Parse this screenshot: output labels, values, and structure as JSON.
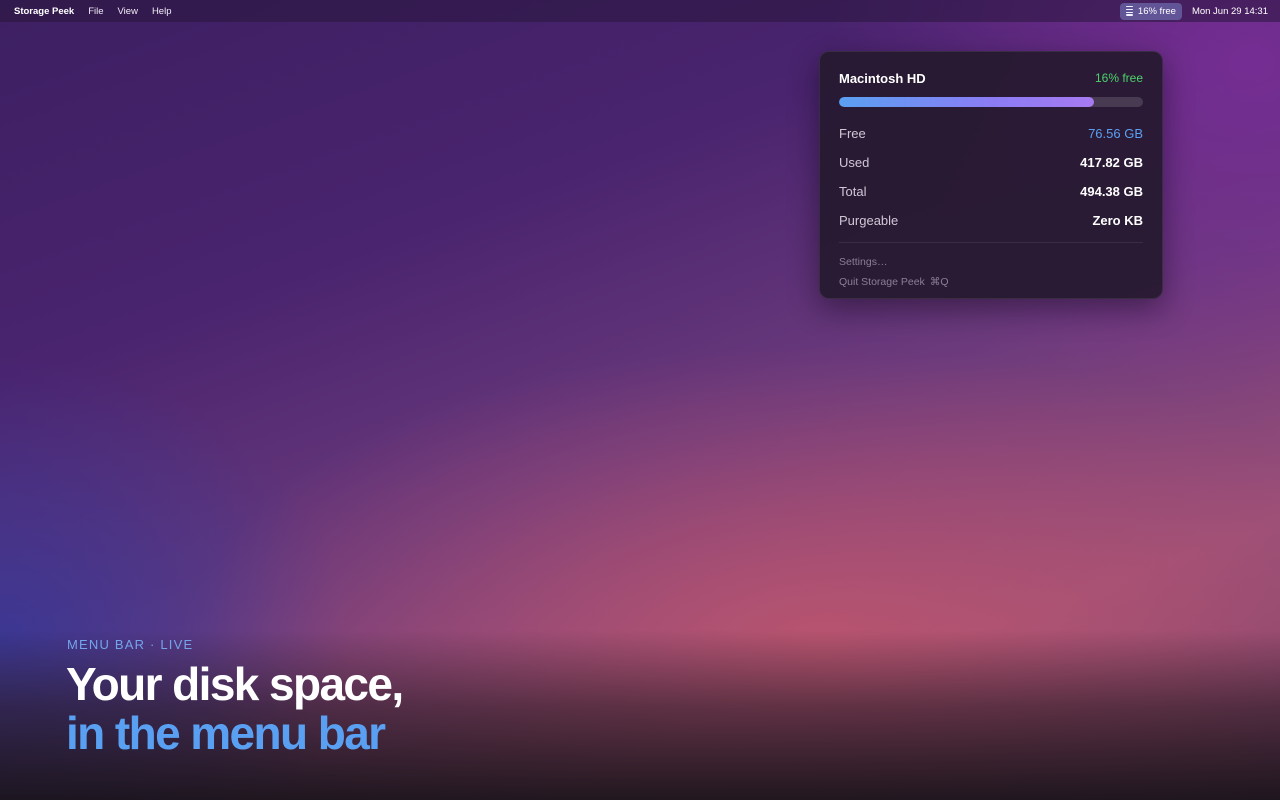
{
  "menubar": {
    "app_name": "Storage Peek",
    "menus": [
      "File",
      "View",
      "Help"
    ],
    "status_item": {
      "icon": "drive-icon",
      "label": "16% free"
    },
    "clock": "Mon Jun 29 14:31"
  },
  "popover": {
    "volume_name": "Macintosh HD",
    "free_percent_label": "16% free",
    "used_fraction": 0.84,
    "stats": [
      {
        "label": "Free",
        "value": "76.56 GB"
      },
      {
        "label": "Used",
        "value": "417.82 GB"
      },
      {
        "label": "Total",
        "value": "494.38 GB"
      },
      {
        "label": "Purgeable",
        "value": "Zero KB"
      }
    ],
    "actions": {
      "settings": "Settings…",
      "quit": "Quit Storage Peek",
      "quit_shortcut": "⌘Q"
    }
  },
  "hero": {
    "eyebrow": "MENU BAR · LIVE",
    "line1": "Your disk space,",
    "line2": "in the menu bar"
  },
  "colors": {
    "accent_blue": "#5aa0f2",
    "free_green": "#4cd36a"
  }
}
